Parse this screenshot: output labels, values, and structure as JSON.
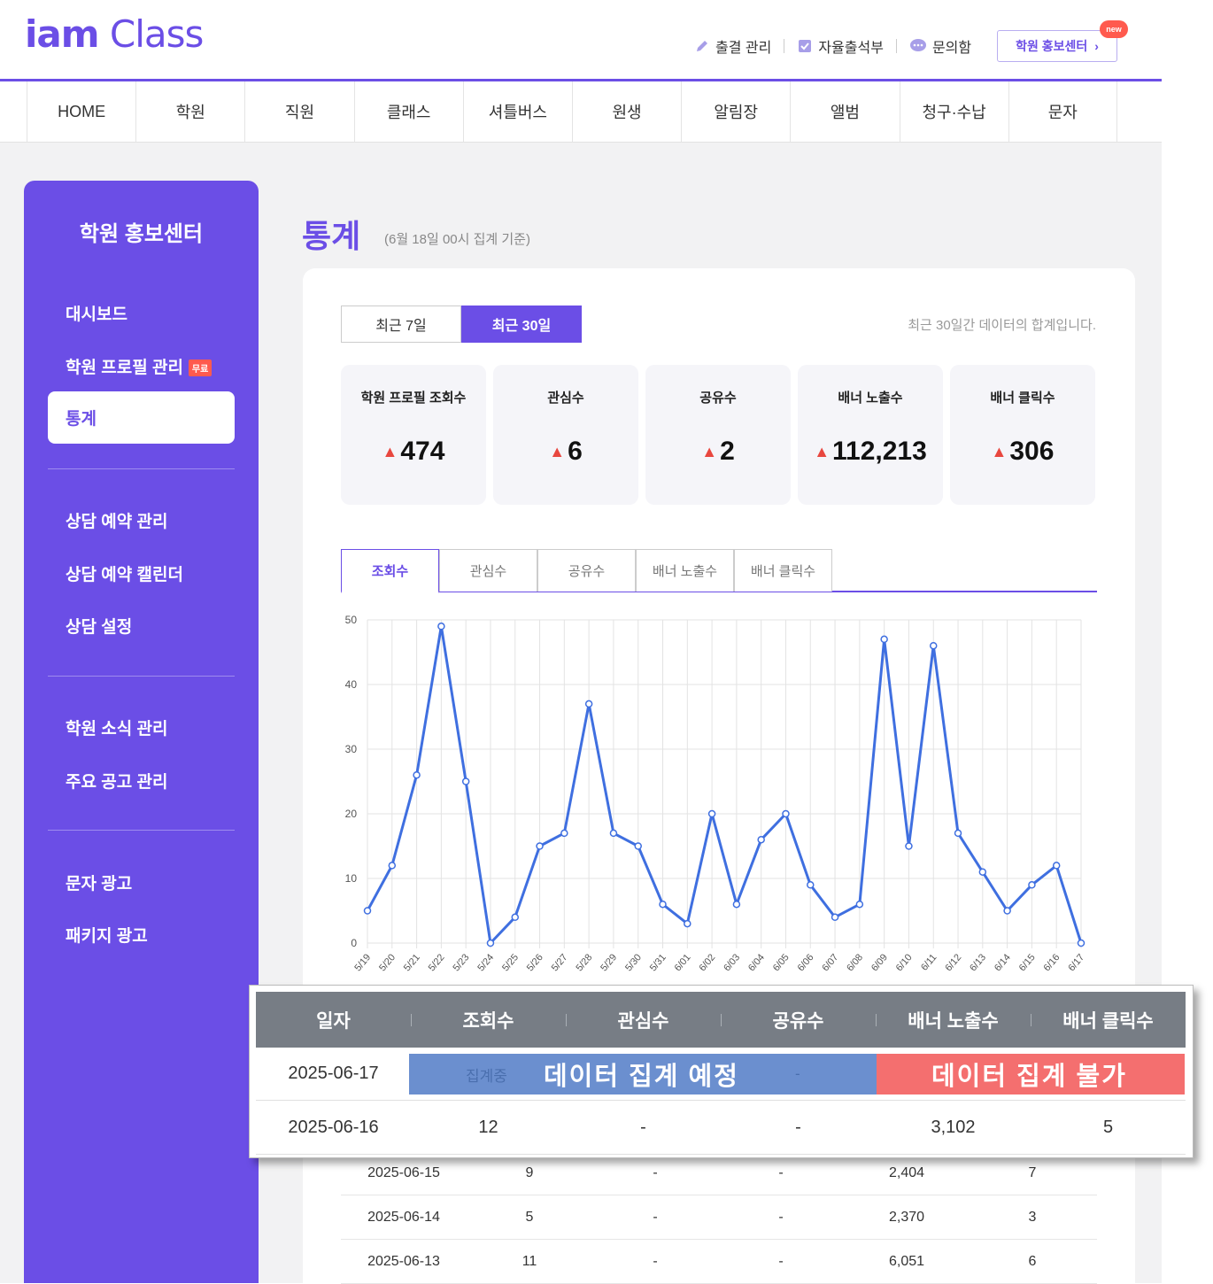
{
  "brand": {
    "logo_bold": "iam",
    "logo_light": "Class"
  },
  "util_menu": [
    {
      "icon": "pencil-icon",
      "label": "출결 관리"
    },
    {
      "icon": "checkbox-icon",
      "label": "자율출석부"
    },
    {
      "icon": "chat-bubble-icon",
      "label": "문의함"
    }
  ],
  "promo_button": {
    "label": "학원 홍보센터",
    "badge": "new"
  },
  "gnb": [
    "HOME",
    "학원",
    "직원",
    "클래스",
    "셔틀버스",
    "원생",
    "알림장",
    "앨범",
    "청구·수납",
    "문자"
  ],
  "sidebar": {
    "title": "학원 홍보센터",
    "items": [
      {
        "label": "대시보드"
      },
      {
        "label": "학원 프로필 관리",
        "badge": "무료"
      },
      {
        "label": "통계"
      },
      {
        "label": "상담 예약 관리"
      },
      {
        "label": "상담 예약 캘린더"
      },
      {
        "label": "상담 설정"
      },
      {
        "label": "학원 소식 관리"
      },
      {
        "label": "주요 공고 관리"
      },
      {
        "label": "문자 광고"
      },
      {
        "label": "패키지 광고"
      }
    ]
  },
  "page": {
    "title": "통계",
    "subtitle": "(6월 18일 00시 집계 기준)"
  },
  "period": {
    "tab_7": "최근 7일",
    "tab_30": "최근 30일",
    "selected": "최근 30일",
    "note": "최근 30일간 데이터의 합계입니다."
  },
  "stats": [
    {
      "label": "학원 프로필 조회수",
      "value": "474"
    },
    {
      "label": "관심수",
      "value": "6"
    },
    {
      "label": "공유수",
      "value": "2"
    },
    {
      "label": "배너 노출수",
      "value": "112,213"
    },
    {
      "label": "배너 클릭수",
      "value": "306"
    }
  ],
  "chart_tabs": [
    "조회수",
    "관심수",
    "공유수",
    "배너 노출수",
    "배너 클릭수"
  ],
  "chart_data": {
    "type": "line",
    "x": [
      "5/19",
      "5/20",
      "5/21",
      "5/22",
      "5/23",
      "5/24",
      "5/25",
      "5/26",
      "5/27",
      "5/28",
      "5/29",
      "5/30",
      "5/31",
      "6/01",
      "6/02",
      "6/03",
      "6/04",
      "6/05",
      "6/06",
      "6/07",
      "6/08",
      "6/09",
      "6/10",
      "6/11",
      "6/12",
      "6/13",
      "6/14",
      "6/15",
      "6/16",
      "6/17"
    ],
    "series": [
      {
        "values": [
          5,
          12,
          26,
          49,
          25,
          0,
          4,
          15,
          17,
          37,
          17,
          15,
          6,
          3,
          20,
          6,
          16,
          20,
          9,
          4,
          6,
          47,
          15,
          46,
          17,
          11,
          5,
          9,
          12,
          0
        ]
      }
    ],
    "ylim": [
      0,
      50
    ],
    "yticks": [
      0,
      10,
      20,
      30,
      40,
      50
    ],
    "grid": true,
    "color": "#3f6fe0"
  },
  "overlay_table": {
    "headers": [
      "일자",
      "조회수",
      "관심수",
      "공유수",
      "배너 노출수",
      "배너 클릭수"
    ],
    "row1": {
      "date": "2025-06-17",
      "faint_views": "집계중",
      "faint_shares": "-"
    },
    "band_pending": "데이터 집계 예정",
    "band_unavailable": "데이터 집계 불가",
    "row2": [
      "2025-06-16",
      "12",
      "-",
      "-",
      "3,102",
      "5"
    ]
  },
  "lower_rows": [
    [
      "2025-06-15",
      "9",
      "-",
      "-",
      "2,404",
      "7"
    ],
    [
      "2025-06-14",
      "5",
      "-",
      "-",
      "2,370",
      "3"
    ],
    [
      "2025-06-13",
      "11",
      "-",
      "-",
      "6,051",
      "6"
    ]
  ],
  "colors": {
    "accent": "#6b4ee6",
    "up_arrow": "#e8473f",
    "band_blue": "#6b8fcf",
    "band_red": "#f46f6f"
  }
}
